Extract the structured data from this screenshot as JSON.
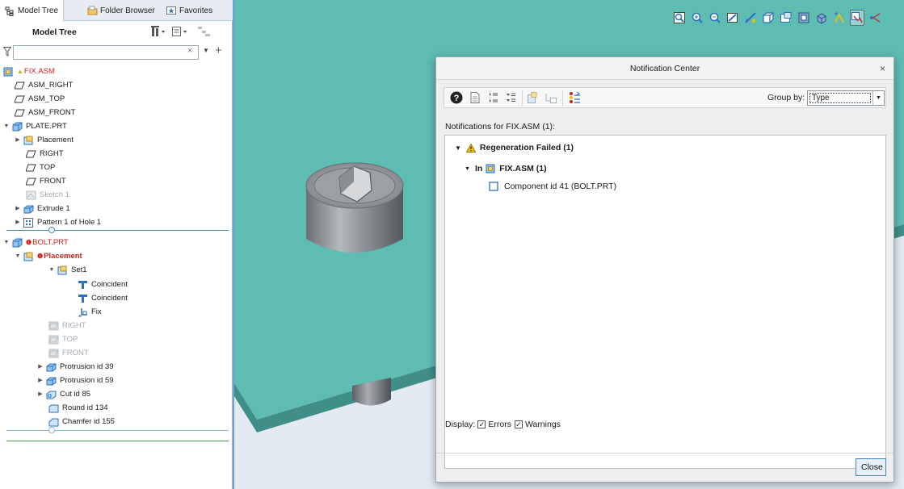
{
  "tabs": [
    {
      "label": "Model Tree"
    },
    {
      "label": "Folder Browser"
    },
    {
      "label": "Favorites"
    }
  ],
  "model_tree": {
    "title": "Model Tree",
    "search": {
      "value": "",
      "placeholder": ""
    },
    "clear_glyph": "×",
    "add_glyph": "+",
    "items": [
      {
        "label": "FIX.ASM"
      },
      {
        "label": "ASM_RIGHT"
      },
      {
        "label": "ASM_TOP"
      },
      {
        "label": "ASM_FRONT"
      },
      {
        "label": "PLATE.PRT"
      },
      {
        "label": "Placement"
      },
      {
        "label": "RIGHT"
      },
      {
        "label": "TOP"
      },
      {
        "label": "FRONT"
      },
      {
        "label": "Sketch 1"
      },
      {
        "label": "Extrude 1"
      },
      {
        "label": "Pattern 1 of Hole 1"
      },
      {
        "label": "BOLT.PRT"
      },
      {
        "label": "Placement"
      },
      {
        "label": "Set1"
      },
      {
        "label": "Coincident"
      },
      {
        "label": "Coincident"
      },
      {
        "label": "Fix"
      },
      {
        "label": "RIGHT"
      },
      {
        "label": "TOP"
      },
      {
        "label": "FRONT"
      },
      {
        "label": "Protrusion id 39"
      },
      {
        "label": "Protrusion id 59"
      },
      {
        "label": "Cut id 85"
      },
      {
        "label": "Round id 134"
      },
      {
        "label": "Chamfer id 155"
      }
    ]
  },
  "notification_center": {
    "title": "Notification Center",
    "close_glyph": "×",
    "group_by_label": "Group by:",
    "group_by_value": "Type",
    "notifications_for": "Notifications for FIX.ASM (1):",
    "groups": [
      {
        "label": "Regeneration Failed (1)",
        "sub": {
          "label": "In",
          "model": "FIX.ASM (1)",
          "item": "Component id 41 (BOLT.PRT)"
        }
      }
    ],
    "display_label": "Display:",
    "errors_label": "Errors",
    "warnings_label": "Warnings",
    "errors_checked": true,
    "warnings_checked": true,
    "close_button": "Close"
  },
  "colors": {
    "plate": "#5fbcb3",
    "plate_edge": "#3f8f88",
    "error_red": "#d0201c",
    "warning_yellow": "#f2c200",
    "accent_blue": "#2f6fbd"
  }
}
